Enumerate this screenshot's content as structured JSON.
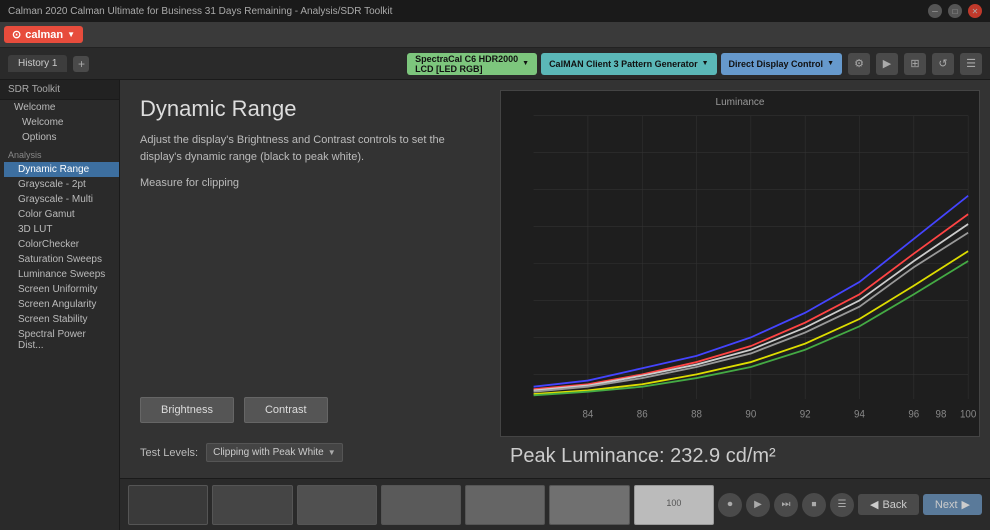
{
  "titleBar": {
    "title": "Calman 2020 Calman Ultimate for Business 31 Days Remaining - Analysis/SDR Toolkit"
  },
  "menuBar": {
    "logo": "calman",
    "arrow": "▼"
  },
  "toolbar": {
    "historyTab": "History 1",
    "addHistory": "+",
    "devices": [
      {
        "label": "SpectraCal C6 HDR2000 LCD [LED RGB]",
        "color": "pill-green"
      },
      {
        "label": "CalMAN Client 3 Pattern Generator",
        "color": "pill-teal"
      },
      {
        "label": "Direct Display Control",
        "color": "pill-blue"
      }
    ],
    "icons": [
      "⚙",
      "▶",
      "⊞",
      "↺",
      "☰"
    ]
  },
  "sidebar": {
    "title": "SDR Toolkit",
    "items": [
      {
        "label": "Welcome",
        "active": false,
        "indent": false
      },
      {
        "label": "Welcome",
        "active": false,
        "indent": true
      },
      {
        "label": "Options",
        "active": false,
        "indent": true
      },
      {
        "label": "Analysis",
        "active": false,
        "indent": false,
        "isGroup": true
      },
      {
        "label": "Dynamic Range",
        "active": true,
        "indent": true
      },
      {
        "label": "Grayscale - 2pt",
        "active": false,
        "indent": true
      },
      {
        "label": "Grayscale - Multi",
        "active": false,
        "indent": true
      },
      {
        "label": "Color Gamut",
        "active": false,
        "indent": true
      },
      {
        "label": "3D LUT",
        "active": false,
        "indent": true
      },
      {
        "label": "ColorChecker",
        "active": false,
        "indent": true
      },
      {
        "label": "Saturation Sweeps",
        "active": false,
        "indent": true
      },
      {
        "label": "Luminance Sweeps",
        "active": false,
        "indent": true
      },
      {
        "label": "Screen Uniformity",
        "active": false,
        "indent": true
      },
      {
        "label": "Screen Angularity",
        "active": false,
        "indent": true
      },
      {
        "label": "Screen Stability",
        "active": false,
        "indent": true
      },
      {
        "label": "Spectral Power Dist...",
        "active": false,
        "indent": true
      }
    ]
  },
  "page": {
    "title": "Dynamic Range",
    "description": "Adjust the display's Brightness and Contrast controls to set the display's dynamic range (black to peak white).",
    "measureText": "Measure for clipping",
    "buttons": {
      "brightness": "Brightness",
      "contrast": "Contrast"
    },
    "testLevels": {
      "label": "Test Levels:",
      "value": "Clipping with Peak White"
    },
    "peakLuminance": "Peak Luminance: 232.9  cd/m²",
    "chart": {
      "title": "Luminance",
      "xLabels": [
        "84",
        "86",
        "88",
        "90",
        "92",
        "94",
        "96",
        "98",
        "100"
      ],
      "lines": [
        {
          "color": "#4444ff",
          "name": "blue"
        },
        {
          "color": "#ff4444",
          "name": "red"
        },
        {
          "color": "#888888",
          "name": "gray"
        },
        {
          "color": "#ffffff",
          "name": "white"
        },
        {
          "color": "#dddd00",
          "name": "yellow"
        },
        {
          "color": "#44aa44",
          "name": "green"
        }
      ]
    }
  },
  "filmstrip": {
    "cells": [
      {
        "brightness": "dark"
      },
      {
        "brightness": "dark"
      },
      {
        "brightness": "dark"
      },
      {
        "brightness": "dark"
      },
      {
        "brightness": "dark"
      },
      {
        "brightness": "dark"
      },
      {
        "brightness": "light"
      }
    ],
    "cellLabel": "100"
  },
  "navButtons": {
    "back": "Back",
    "next": "Next ▶"
  }
}
